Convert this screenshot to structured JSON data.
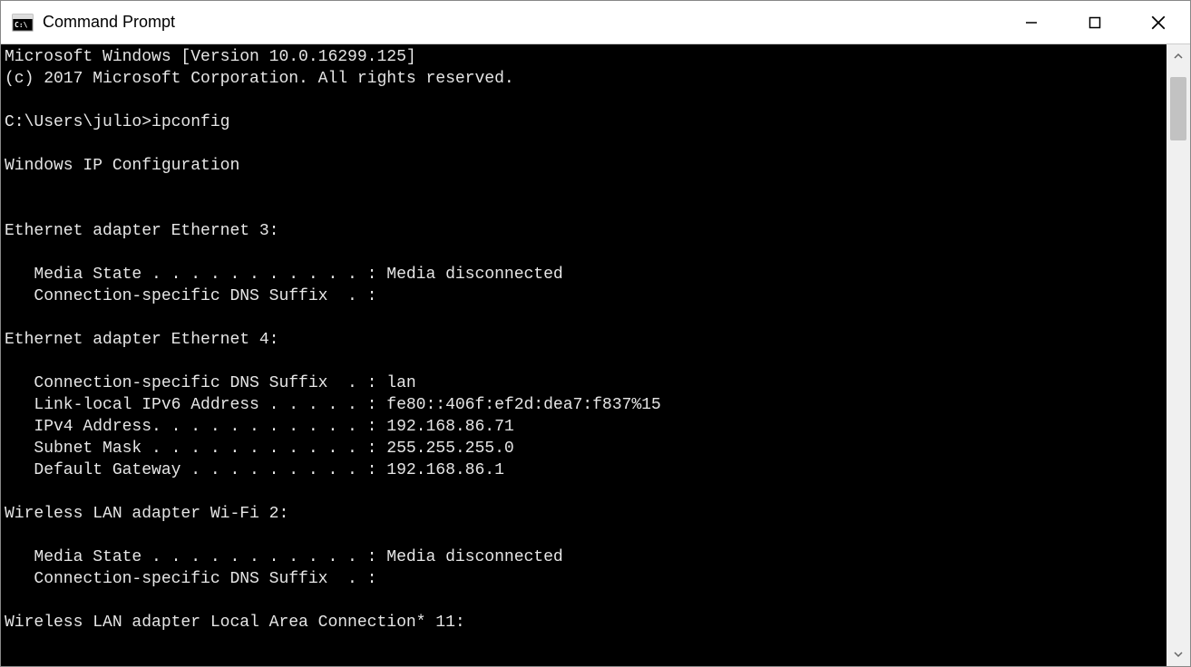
{
  "window": {
    "title": "Command Prompt"
  },
  "console": {
    "lines": [
      "Microsoft Windows [Version 10.0.16299.125]",
      "(c) 2017 Microsoft Corporation. All rights reserved.",
      "",
      "C:\\Users\\julio>ipconfig",
      "",
      "Windows IP Configuration",
      "",
      "",
      "Ethernet adapter Ethernet 3:",
      "",
      "   Media State . . . . . . . . . . . : Media disconnected",
      "   Connection-specific DNS Suffix  . :",
      "",
      "Ethernet adapter Ethernet 4:",
      "",
      "   Connection-specific DNS Suffix  . : lan",
      "   Link-local IPv6 Address . . . . . : fe80::406f:ef2d:dea7:f837%15",
      "   IPv4 Address. . . . . . . . . . . : 192.168.86.71",
      "   Subnet Mask . . . . . . . . . . . : 255.255.255.0",
      "   Default Gateway . . . . . . . . . : 192.168.86.1",
      "",
      "Wireless LAN adapter Wi-Fi 2:",
      "",
      "   Media State . . . . . . . . . . . : Media disconnected",
      "   Connection-specific DNS Suffix  . :",
      "",
      "Wireless LAN adapter Local Area Connection* 11:"
    ]
  }
}
